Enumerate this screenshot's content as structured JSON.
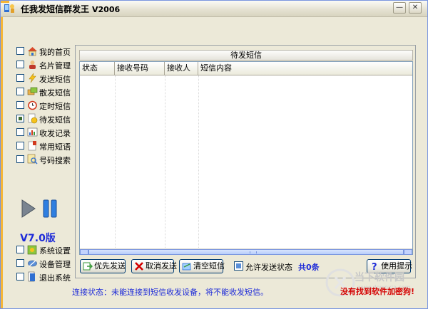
{
  "window": {
    "title": "任我发短信群发王",
    "version_tag": "V2006",
    "min_glyph": "—",
    "close_glyph": "✕",
    "accent_color": "#f5b638"
  },
  "sidebar": {
    "items": [
      {
        "label": "我的首页",
        "icon": "home-icon",
        "checked": false
      },
      {
        "label": "名片管理",
        "icon": "card-icon",
        "checked": false
      },
      {
        "label": "发送短信",
        "icon": "send-icon",
        "checked": false
      },
      {
        "label": "散发短信",
        "icon": "scatter-icon",
        "checked": false
      },
      {
        "label": "定时短信",
        "icon": "clock-icon",
        "checked": false
      },
      {
        "label": "待发短信",
        "icon": "pending-icon",
        "checked": true
      },
      {
        "label": "收发记录",
        "icon": "record-icon",
        "checked": false
      },
      {
        "label": "常用短语",
        "icon": "phrase-icon",
        "checked": false
      },
      {
        "label": "号码搜索",
        "icon": "search-icon",
        "checked": false
      }
    ],
    "version": "V7.0版",
    "bottom_items": [
      {
        "label": "系统设置",
        "icon": "settings-icon"
      },
      {
        "label": "设备管理",
        "icon": "device-icon"
      },
      {
        "label": "退出系统",
        "icon": "exit-icon"
      }
    ]
  },
  "panel": {
    "title": "待发短信",
    "columns": [
      "状态",
      "接收号码",
      "接收人",
      "短信内容"
    ]
  },
  "buttons": {
    "priority": "优先发送",
    "cancel": "取消发送",
    "clear": "清空短信",
    "allow": "允许发送状态",
    "count": "共0条",
    "help": "使用提示"
  },
  "status": {
    "text": "连接状态：未能连接到短信收发设备，将不能收发短信。",
    "warning": "没有找到软件加密狗!"
  },
  "watermark": {
    "text": "当下软件园",
    "sub": "www.downxia.com"
  }
}
